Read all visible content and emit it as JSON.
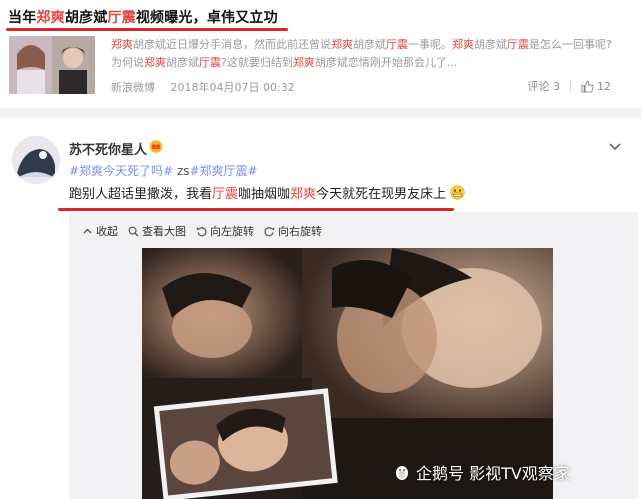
{
  "headline": {
    "part1": "当年",
    "name1": "郑爽",
    "part2": "胡彦斌",
    "name2": "厅震",
    "part3": "视频曝光，卓伟又立功"
  },
  "summary": {
    "s1": "郑爽",
    "s2": "胡彦斌近日爆分手消息，然而此前还曾说",
    "s3": "郑爽",
    "s4": "胡彦斌",
    "s5": "厅震",
    "s6": "一事呢。",
    "s7": "郑爽",
    "s8": "胡彦斌",
    "s9": "厅震",
    "s10": "是怎么一回事呢?",
    "s11": "为何说",
    "s12": "郑爽",
    "s13": "胡彦斌",
    "s14": "厅震",
    "s15": "?这就要归结到",
    "s16": "郑爽",
    "s17": "胡彦斌恋情刚开始那会儿了..."
  },
  "meta": {
    "source": "新浪微博",
    "date": "2018年04月07日 00:32"
  },
  "actions": {
    "comments": "评论 3",
    "likes": "12"
  },
  "post": {
    "username": "苏不死你星人",
    "tag1": "#郑爽今天死了吗#",
    "tag_mid": " zs",
    "tag2": "#郑爽厅震#",
    "t1": "跑别人超话里撒泼，我看",
    "t2": "厅震",
    "t3": "咖抽烟咖",
    "t4": "郑爽",
    "t5": "今天就死在现男友床上"
  },
  "toolbar": {
    "collapse": "收起",
    "view_large": "查看大图",
    "rotate_left": "向左旋转",
    "rotate_right": "向右旋转"
  },
  "watermark": {
    "text": "企鹅号 影视TV观察家"
  },
  "colors": {
    "highlight": "#e2473c",
    "hashtag": "#7a8ef0",
    "underline": "#d9262a"
  }
}
